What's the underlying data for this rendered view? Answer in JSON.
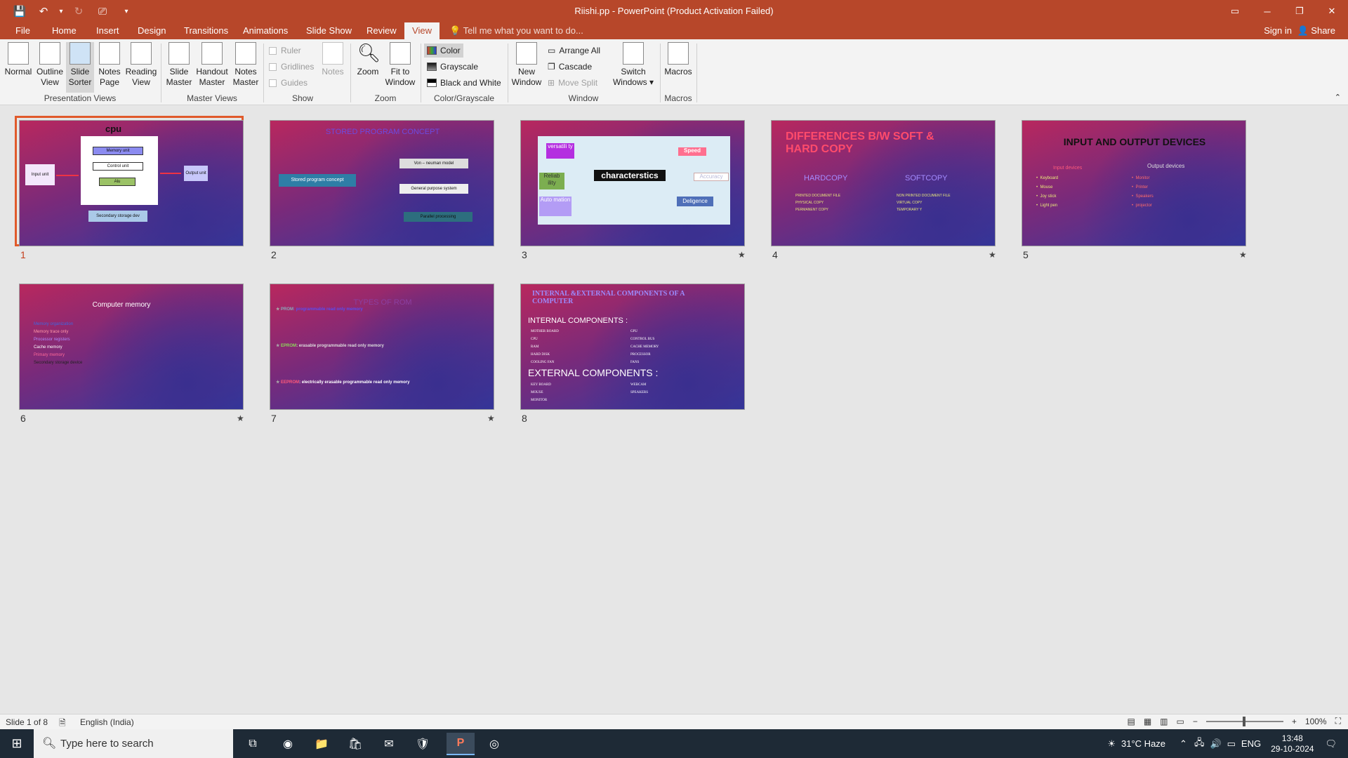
{
  "window": {
    "title": "Riishi.pp - PowerPoint (Product Activation Failed)",
    "controls": [
      "▭",
      "─",
      "❐",
      "✕"
    ]
  },
  "qat": {
    "save": "💾",
    "undo": "↶",
    "undo_menu": "▾",
    "redo": "↻",
    "present": "⎚",
    "customize": "▾"
  },
  "tabs": [
    "File",
    "Home",
    "Insert",
    "Design",
    "Transitions",
    "Animations",
    "Slide Show",
    "Review",
    "View"
  ],
  "active_tab": "View",
  "tell_me": "Tell me what you want to do...",
  "sign_in": "Sign in",
  "share": "Share",
  "ribbon": {
    "presentation_views": {
      "label": "Presentation Views",
      "normal": "Normal",
      "outline_view": [
        "Outline",
        "View"
      ],
      "slide_sorter": [
        "Slide",
        "Sorter"
      ],
      "notes_page": [
        "Notes",
        "Page"
      ],
      "reading_view": [
        "Reading",
        "View"
      ]
    },
    "master_views": {
      "label": "Master Views",
      "slide_master": [
        "Slide",
        "Master"
      ],
      "handout_master": [
        "Handout",
        "Master"
      ],
      "notes_master": [
        "Notes",
        "Master"
      ]
    },
    "show": {
      "label": "Show",
      "ruler": "Ruler",
      "gridlines": "Gridlines",
      "guides": "Guides",
      "notes": "Notes"
    },
    "zoom": {
      "label": "Zoom",
      "zoom": "Zoom",
      "fit": [
        "Fit to",
        "Window"
      ]
    },
    "color": {
      "label": "Color/Grayscale",
      "color": "Color",
      "grayscale": "Grayscale",
      "bw": "Black and White"
    },
    "window": {
      "label": "Window",
      "new_window": [
        "New",
        "Window"
      ],
      "arrange_all": "Arrange All",
      "cascade": "Cascade",
      "move_split": "Move Split",
      "switch_windows": [
        "Switch",
        "Windows ▾"
      ]
    },
    "macros": {
      "label": "Macros",
      "macros": "Macros"
    }
  },
  "slides": [
    {
      "num": "1",
      "has_star": false,
      "title": "cpu",
      "labels": {
        "memory": "Memory unit",
        "control": "Control unit",
        "alu": "Alu",
        "input": "Input unit",
        "output": "Output unit",
        "secondary": "Secondary storage dev"
      }
    },
    {
      "num": "2",
      "has_star": false,
      "title": "STORED PROGRAM CONCEPT",
      "labels": {
        "center": "Stored program concept",
        "a": "Von – neuman model",
        "b": "General purpose system",
        "c": "Parallel processing"
      }
    },
    {
      "num": "3",
      "has_star": true,
      "labels": {
        "center": "characterstics",
        "versatility": "versatili ty",
        "speed": "Speed",
        "reliability": "Reliab ility",
        "accuracy": "Accuracy",
        "automation": "Auto mation",
        "diligence": "Deligence"
      }
    },
    {
      "num": "4",
      "has_star": true,
      "title": "DIFFERENCES B/W SOFT & HARD COPY",
      "hard": "HARDCOPY",
      "soft": "SOFTCOPY",
      "hard_items": [
        "PRINTED DOCUMENT FILE",
        "PHYSICAL COPY",
        "PERMANENT COPY"
      ],
      "soft_items": [
        "NON PRINTED DOCUMENT FILE",
        "VIRTUAL COPY",
        "TEMPORARY Y"
      ]
    },
    {
      "num": "5",
      "has_star": true,
      "title": "INPUT AND OUTPUT DEVICES",
      "input_head": "Input devices",
      "output_head": "Output devices",
      "inputs": [
        "Keyboard",
        "Mouse",
        "Joy stick",
        "Light pen"
      ],
      "outputs": [
        "Monitor",
        "Printer",
        "Speakers",
        "projector"
      ]
    },
    {
      "num": "6",
      "has_star": true,
      "title": "Computer memory",
      "items": [
        "Memory organization",
        "Memory trace only",
        "Processor registers",
        "Cache memory",
        "Primary memory",
        "Secondary storage device"
      ]
    },
    {
      "num": "7",
      "has_star": true,
      "title": "TYPES OF ROM",
      "lines": [
        {
          "k": "PROM",
          "v": ": programmable read only memory"
        },
        {
          "k": "EPROM",
          "v": ": erasable programmable read only memory"
        },
        {
          "k": "EEPROM",
          "v": ": electrically erasable programmable read only memory"
        }
      ]
    },
    {
      "num": "8",
      "has_star": false,
      "title": "INTERNAL &EXTERNAL COMPONENTS OF A    COMPUTER",
      "internal": "INTERNAL COMPONENTS :",
      "int_left": [
        "MOTHER BOARD",
        "CPU",
        "RAM",
        "HARD DISK",
        "COOLING FAN"
      ],
      "int_right": [
        "GPU",
        "CONTROL BUS",
        "CACHE MEMORY",
        "PROCESSOR",
        "FANS"
      ],
      "external": "EXTERNAL COMPONENTS :",
      "ext_left": [
        "KEY BOARD",
        "MOUSE",
        "MONITOR"
      ],
      "ext_right": [
        "WEBCAM",
        "SPEAKERS"
      ]
    }
  ],
  "status": {
    "slide": "Slide 1 of 8",
    "language": "English (India)",
    "zoom": "100%"
  },
  "taskbar": {
    "search": "Type here to search",
    "weather": "31°C  Haze",
    "lang": "ENG",
    "time": "13:48",
    "date": "29-10-2024"
  }
}
